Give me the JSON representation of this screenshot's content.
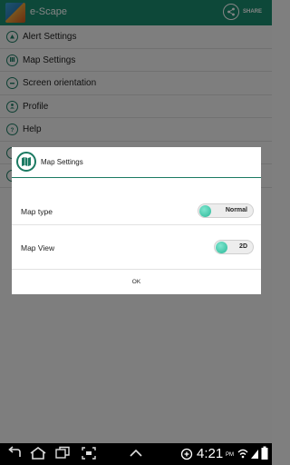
{
  "app": {
    "title": "e-Scape",
    "share_label": "SHARE"
  },
  "menu": {
    "items": [
      {
        "label": "Alert Settings",
        "icon": "alert-icon"
      },
      {
        "label": "Map Settings",
        "icon": "map-icon"
      },
      {
        "label": "Screen orientation",
        "icon": "orientation-icon"
      },
      {
        "label": "Profile",
        "icon": "profile-icon"
      },
      {
        "label": "Help",
        "icon": "help-icon"
      },
      {
        "label": "",
        "icon": "info-icon"
      },
      {
        "label": "",
        "icon": "exit-icon"
      }
    ]
  },
  "dialog": {
    "title": "Map Settings",
    "icon": "map-icon",
    "rows": [
      {
        "label": "Map type",
        "value": "Normal"
      },
      {
        "label": "Map View",
        "value": "2D"
      }
    ],
    "ok_label": "OK"
  },
  "status": {
    "time": "4:21",
    "ampm": "PM"
  },
  "colors": {
    "accent": "#1a8a6e",
    "toggle_knob": "#2ab898"
  }
}
